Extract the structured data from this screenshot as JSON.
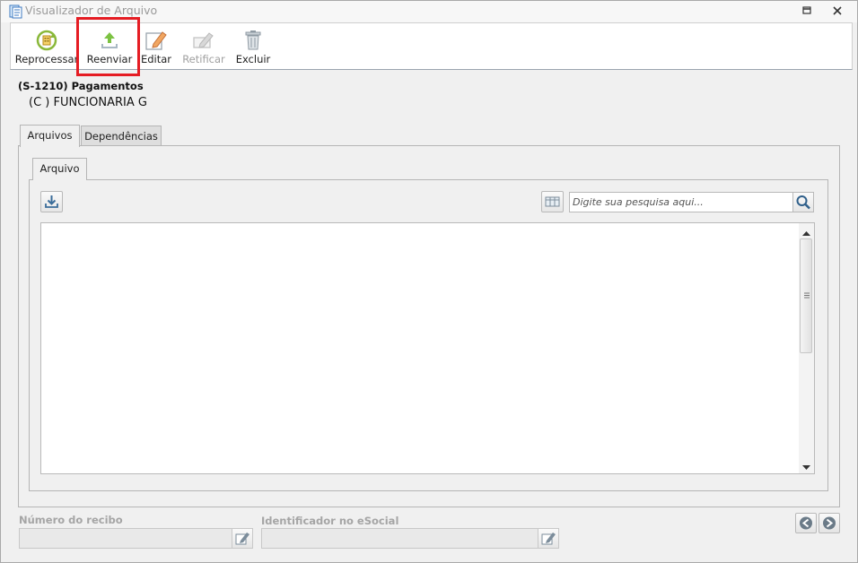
{
  "window": {
    "title": "Visualizador de Arquivo",
    "icons": [
      "document-viewer-icon",
      "restore-icon",
      "close-icon"
    ]
  },
  "toolbar": {
    "buttons": [
      {
        "label": "Reprocessar",
        "icon": "reprocess-icon",
        "enabled": true
      },
      {
        "label": "Reenviar",
        "icon": "upload-icon",
        "enabled": true,
        "highlighted": true
      },
      {
        "label": "Editar",
        "icon": "edit-icon",
        "enabled": true
      },
      {
        "label": "Retificar",
        "icon": "rectify-icon",
        "enabled": false
      },
      {
        "label": "Excluir",
        "icon": "trash-icon",
        "enabled": true
      }
    ],
    "highlight_color": "#e51c23"
  },
  "header": {
    "event_title": "(S-1210) Pagamentos",
    "employee": "(C              ) FUNCIONARIA G"
  },
  "tabs": [
    {
      "label": "Arquivos",
      "active": true
    },
    {
      "label": "Dependências",
      "active": false
    }
  ],
  "subtabs": [
    {
      "label": "Arquivo",
      "active": true
    }
  ],
  "search": {
    "placeholder": "Digite sua pesquisa aqui...",
    "value": ""
  },
  "footer": {
    "receipt_label": "Número do recibo",
    "receipt_value": "",
    "esocial_label": "Identificador no eSocial",
    "esocial_value": ""
  }
}
